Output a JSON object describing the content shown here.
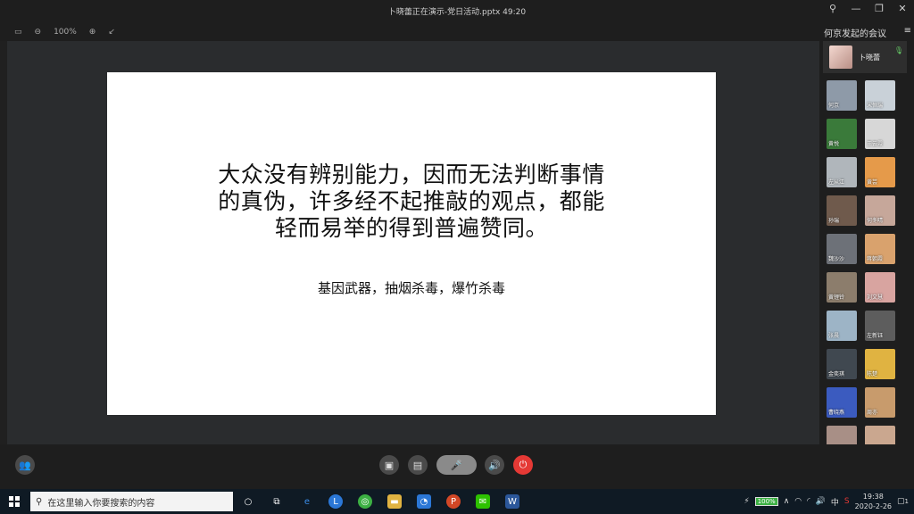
{
  "window": {
    "title": "卜晓蕾正在演示-党日活动.pptx 49:20",
    "controls": [
      "pin-icon",
      "minimize-icon",
      "restore-icon",
      "close-icon"
    ]
  },
  "toolbar": {
    "zoom": "100%"
  },
  "slide": {
    "main_line1": "大众没有辨别能力，因而无法判断事情",
    "main_line2": "的真伪，许多经不起推敲的观点，都能",
    "main_line3": "轻而易举的得到普遍赞同。",
    "sub_text": "基因武器，抽烟杀毒，爆竹杀毒"
  },
  "sidebar": {
    "title": "何京发起的会议",
    "host_name": "卜晓蕾",
    "participants": [
      {
        "name": "何京",
        "color": "#8e9aa8"
      },
      {
        "name": "宋恒瑞",
        "color": "#c9d1d8"
      },
      {
        "name": "黄悦",
        "color": "#3a7a3a"
      },
      {
        "name": "王云霞",
        "color": "#d7d7d7"
      },
      {
        "name": "左从江",
        "color": "#b0b6bb"
      },
      {
        "name": "黄芸",
        "color": "#e59a4a"
      },
      {
        "name": "孙瑞",
        "color": "#6f5a4c"
      },
      {
        "name": "何冬晴",
        "color": "#c6a79a"
      },
      {
        "name": "魏沙沙",
        "color": "#6d7178"
      },
      {
        "name": "蒋朝霞",
        "color": "#d9a26d"
      },
      {
        "name": "黄锂铃",
        "color": "#8c7d6c"
      },
      {
        "name": "刘文慧",
        "color": "#d8a4a0"
      },
      {
        "name": "张晨",
        "color": "#9db4c6"
      },
      {
        "name": "左新钰",
        "color": "#5d5d5d"
      },
      {
        "name": "金奕琪",
        "color": "#404850"
      },
      {
        "name": "陈楚",
        "color": "#e0b341"
      },
      {
        "name": "曹晓燕",
        "color": "#3b5bbf"
      },
      {
        "name": "周亦",
        "color": "#c89b6c"
      },
      {
        "name": "",
        "color": "#a88f86"
      },
      {
        "name": "",
        "color": "#caa78f"
      }
    ]
  },
  "taskbar": {
    "search_placeholder": "在这里输入你要搜索的内容",
    "battery": "100%",
    "ime": "中",
    "time": "19:38",
    "date": "2020-2-26",
    "notification_count": "1"
  }
}
